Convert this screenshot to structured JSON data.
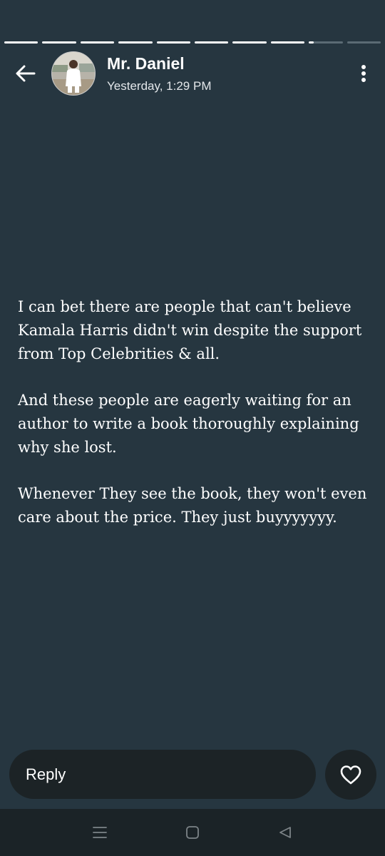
{
  "status": {
    "segments_total": 10,
    "segments_viewed": 8,
    "current_segment_progress": 0.15,
    "author": "Mr. Daniel",
    "timestamp": "Yesterday, 1:29 PM",
    "paragraphs": [
      "I can bet there are people that can't believe Kamala Harris didn't win despite the support from Top Celebrities & all.",
      "And these people are eagerly waiting for an author to write a book thoroughly explaining why she lost.",
      "Whenever They see the book, they won't even care about the price. They just buyyyyyyy."
    ]
  },
  "reply": {
    "placeholder": "Reply"
  },
  "icons": {
    "back": "back-arrow-icon",
    "menu": "more-vertical-icon",
    "like": "heart-icon",
    "nav_recents": "recents-icon",
    "nav_home": "home-icon",
    "nav_back": "nav-back-icon"
  },
  "colors": {
    "background": "#263640",
    "reply_bg": "#1c2326",
    "text": "#ffffff",
    "progress_inactive": "#5b6b74",
    "navbar": "#1b2327"
  }
}
